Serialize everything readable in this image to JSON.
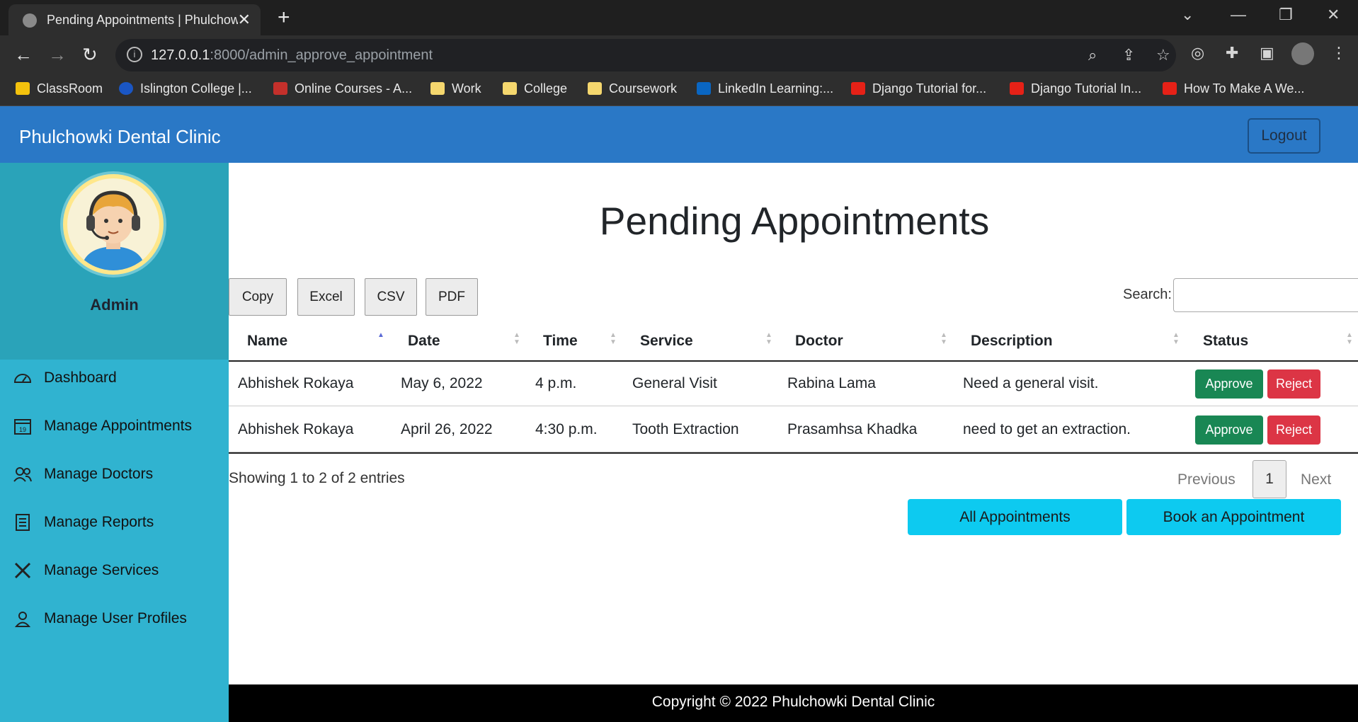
{
  "browser": {
    "tab_title": "Pending Appointments | Phulchowki Dental Clinic",
    "url_host": "127.0.0.1",
    "url_path": ":8000/admin_approve_appointment",
    "bookmarks": [
      "ClassRoom",
      "Islington College |...",
      "Online Courses - A...",
      "Work",
      "College",
      "Coursework",
      "LinkedIn Learning:...",
      "Django Tutorial for...",
      "Django Tutorial In...",
      "How To Make A We..."
    ]
  },
  "navbar": {
    "brand": "Phulchowki Dental Clinic",
    "logout_label": "Logout"
  },
  "sidebar": {
    "user_name": "Admin",
    "items": [
      {
        "label": "Dashboard",
        "icon": "dashboard-icon"
      },
      {
        "label": "Manage Appointments",
        "icon": "calendar-icon"
      },
      {
        "label": "Manage Doctors",
        "icon": "users-icon"
      },
      {
        "label": "Manage Reports",
        "icon": "report-icon"
      },
      {
        "label": "Manage Services",
        "icon": "tools-icon"
      },
      {
        "label": "Manage User Profiles",
        "icon": "user-icon"
      }
    ]
  },
  "main": {
    "title": "Pending Appointments",
    "export_buttons": [
      "Copy",
      "Excel",
      "CSV",
      "PDF"
    ],
    "search_label": "Search:",
    "search_value": "",
    "columns": [
      "Name",
      "Date",
      "Time",
      "Service",
      "Doctor",
      "Description",
      "Status"
    ],
    "rows": [
      {
        "name": "Abhishek Rokaya",
        "date": "May 6, 2022",
        "time": "4 p.m.",
        "service": "General Visit",
        "doctor": "Rabina Lama",
        "description": "Need a general visit."
      },
      {
        "name": "Abhishek Rokaya",
        "date": "April 26, 2022",
        "time": "4:30 p.m.",
        "service": "Tooth Extraction",
        "doctor": "Prasamhsa Khadka",
        "description": "need to get an extraction."
      }
    ],
    "approve_label": "Approve",
    "reject_label": "Reject",
    "info": "Showing 1 to 2 of 2 entries",
    "pagination": {
      "previous": "Previous",
      "current": "1",
      "next": "Next"
    },
    "all_appointments_label": "All Appointments",
    "book_label": "Book an Appointment"
  },
  "footer": {
    "text": "Copyright © 2022 Phulchowki Dental Clinic"
  }
}
